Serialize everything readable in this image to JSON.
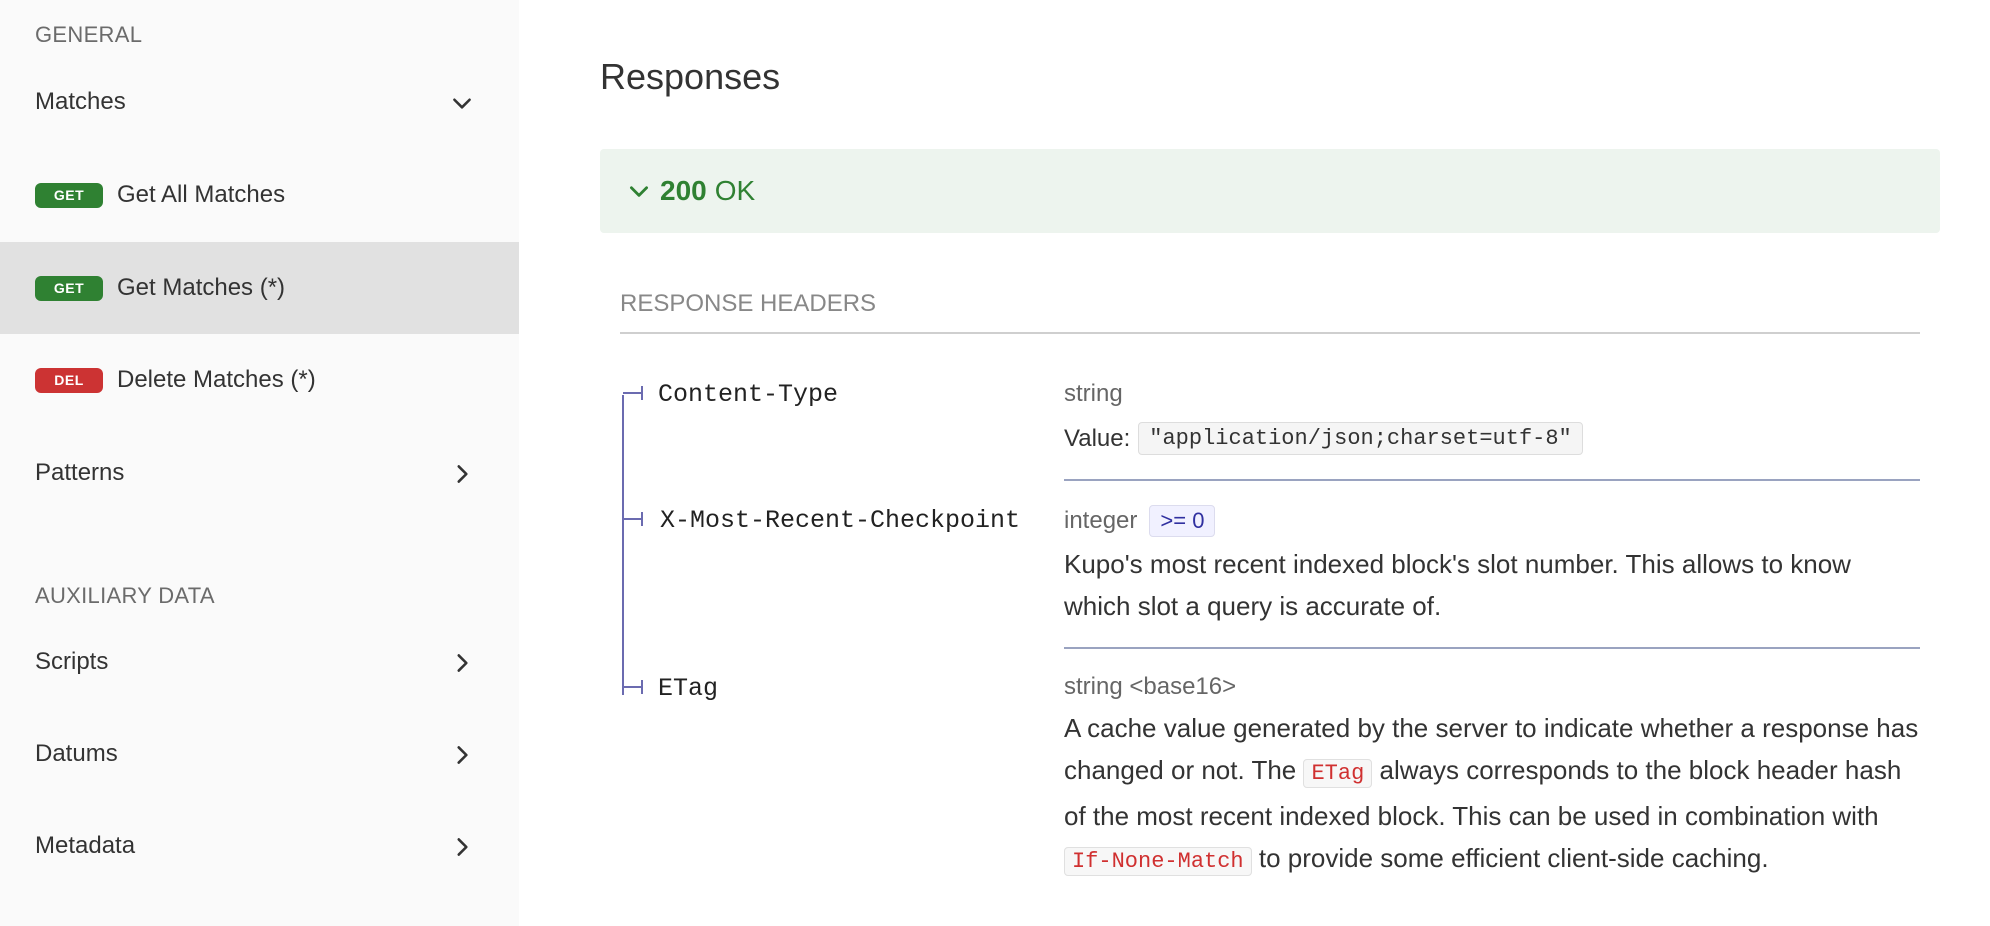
{
  "sidebar": {
    "sections": [
      {
        "label": "GENERAL"
      },
      {
        "label": "AUXILIARY DATA"
      }
    ],
    "items": [
      {
        "label": "Matches",
        "expanded": true,
        "chevron": "chevron-down-icon"
      },
      {
        "label": "Get All Matches",
        "method": "GET"
      },
      {
        "label": "Get Matches (*)",
        "method": "GET",
        "active": true
      },
      {
        "label": "Delete Matches (*)",
        "method": "DEL"
      },
      {
        "label": "Patterns",
        "chevron": "chevron-right-icon"
      },
      {
        "label": "Scripts",
        "chevron": "chevron-right-icon"
      },
      {
        "label": "Datums",
        "chevron": "chevron-right-icon"
      },
      {
        "label": "Metadata",
        "chevron": "chevron-right-icon"
      }
    ]
  },
  "main": {
    "title": "Responses",
    "response": {
      "code": "200",
      "text": "OK"
    },
    "headers_title": "RESPONSE HEADERS",
    "headers": [
      {
        "name": "Content-Type",
        "type": "string",
        "value_label": "Value:",
        "value": "\"application/json;charset=utf-8\""
      },
      {
        "name": "X-Most-Recent-Checkpoint",
        "type": "integer",
        "constraint": ">= 0",
        "description": "Kupo's most recent indexed block's slot number. This allows to know which slot a query is accurate of."
      },
      {
        "name": "ETag",
        "type": "string <base16>",
        "desc_parts": {
          "p1": "A cache value generated by the server to indicate whether a response has changed or not. The ",
          "c1": "ETag",
          "p2": " always corresponds to the block header hash of the most recent indexed block. This can be used in combination with ",
          "c2": "If-None-Match",
          "p3": " to provide some efficient client-side caching."
        }
      }
    ]
  },
  "colors": {
    "get_badge": "#2f8132",
    "del_badge": "#cc3333",
    "success_text": "#2f8132",
    "success_bg": "#edf4ee",
    "active_item_bg": "#e1e1e1",
    "inline_code": "#d03030",
    "tree_line": "#6b6bb0"
  }
}
